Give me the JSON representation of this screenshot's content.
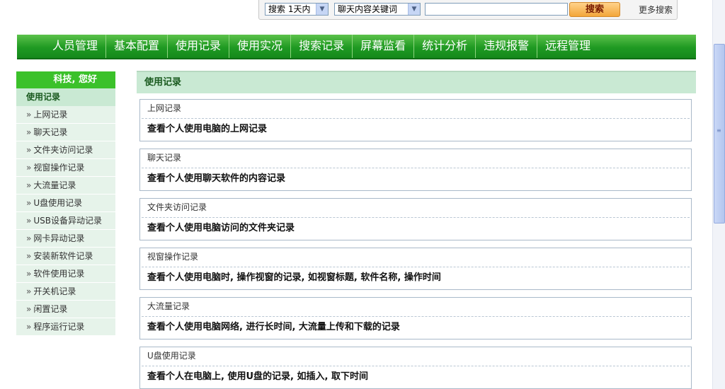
{
  "search": {
    "time_select": "搜索 1天内",
    "type_select": "聊天内容关键词",
    "keyword_value": "",
    "button_label": "搜索",
    "more_label": "更多搜索"
  },
  "nav": {
    "items": [
      {
        "label": "人员管理"
      },
      {
        "label": "基本配置"
      },
      {
        "label": "使用记录"
      },
      {
        "label": "使用实况"
      },
      {
        "label": "搜索记录"
      },
      {
        "label": "屏幕监看"
      },
      {
        "label": "统计分析"
      },
      {
        "label": "违规报警"
      },
      {
        "label": "远程管理"
      }
    ]
  },
  "sidebar": {
    "greeting": "科技, 您好",
    "section_title": "使用记录",
    "items": [
      {
        "label": "上网记录"
      },
      {
        "label": "聊天记录"
      },
      {
        "label": "文件夹访问记录"
      },
      {
        "label": "视窗操作记录"
      },
      {
        "label": "大流量记录"
      },
      {
        "label": "U盘使用记录"
      },
      {
        "label": "USB设备异动记录"
      },
      {
        "label": "网卡异动记录"
      },
      {
        "label": "安装新软件记录"
      },
      {
        "label": "软件使用记录"
      },
      {
        "label": "开关机记录"
      },
      {
        "label": "闲置记录"
      },
      {
        "label": "程序运行记录"
      }
    ]
  },
  "main": {
    "title": "使用记录",
    "cards": [
      {
        "title": "上网记录",
        "desc": "查看个人使用电脑的上网记录"
      },
      {
        "title": "聊天记录",
        "desc": "查看个人使用聊天软件的内容记录"
      },
      {
        "title": "文件夹访问记录",
        "desc": "查看个人使用电脑访问的文件夹记录"
      },
      {
        "title": "视窗操作记录",
        "desc": "查看个人使用电脑时, 操作视窗的记录, 如视窗标题, 软件名称, 操作时间"
      },
      {
        "title": "大流量记录",
        "desc": "查看个人使用电脑网络, 进行长时间, 大流量上传和下载的记录"
      },
      {
        "title": "U盘使用记录",
        "desc": "查看个人在电脑上, 使用U盘的记录, 如插入, 取下时间"
      }
    ]
  },
  "colors": {
    "nav_green": "#1f9a23",
    "greeting_green": "#3bc12a",
    "panel_mint": "#c9e9d3",
    "search_orange": "#f3a63a"
  }
}
